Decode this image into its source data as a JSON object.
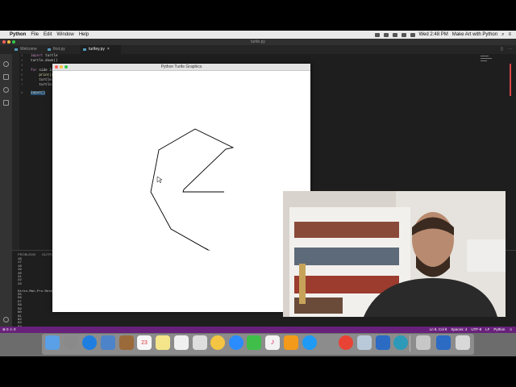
{
  "menubar": {
    "apple_glyph": "",
    "app_name": "Python",
    "items": [
      "File",
      "Edit",
      "Window",
      "Help"
    ],
    "clock": "Wed 2:48 PM",
    "right_text": "Make Art with Python"
  },
  "editor_window": {
    "title": "turtle.py",
    "tabs": [
      {
        "label": "Welcome"
      },
      {
        "label": "first.py"
      },
      {
        "label": "turtley.py"
      }
    ],
    "close_glyph": "×",
    "line_numbers": [
      "1",
      "2",
      "3",
      "4",
      "5",
      "6",
      "7",
      "8"
    ],
    "code_lines": [
      {
        "kw": "import",
        "rest": " turtle"
      },
      {
        "kw": "",
        "rest": "turtle.down()"
      },
      {
        "kw": "",
        "rest": ""
      },
      {
        "kw": "for",
        "rest": " side in"
      },
      {
        "kw": "",
        "rest": "    print(s"
      },
      {
        "kw": "",
        "rest": "    turtle."
      },
      {
        "kw": "",
        "rest": "    turtle."
      },
      {
        "kw": "",
        "rest": "input()"
      }
    ]
  },
  "panel": {
    "tabs": [
      "PROBLEMS",
      "OUTPUT"
    ],
    "terminal_lines": [
      "16",
      "17",
      "18",
      "19",
      "20",
      "21",
      "22",
      "23",
      "",
      "Kirks-Mac-Pro:Desk",
      "55",
      "56",
      "57",
      "58",
      "59",
      "60",
      "61",
      "62",
      "63",
      "64"
    ]
  },
  "status_bar": {
    "left": "⊗ 0 ⚠ 0",
    "items": [
      "Ln 8, Col 8",
      "Spaces: 4",
      "UTF-8",
      "LF",
      "Python"
    ]
  },
  "turtle_window": {
    "title": "Python Turtle Graphics"
  },
  "colors": {
    "status_bar": "#68217a",
    "editor_bg": "#1e1e1e",
    "activity_bar": "#333333"
  }
}
